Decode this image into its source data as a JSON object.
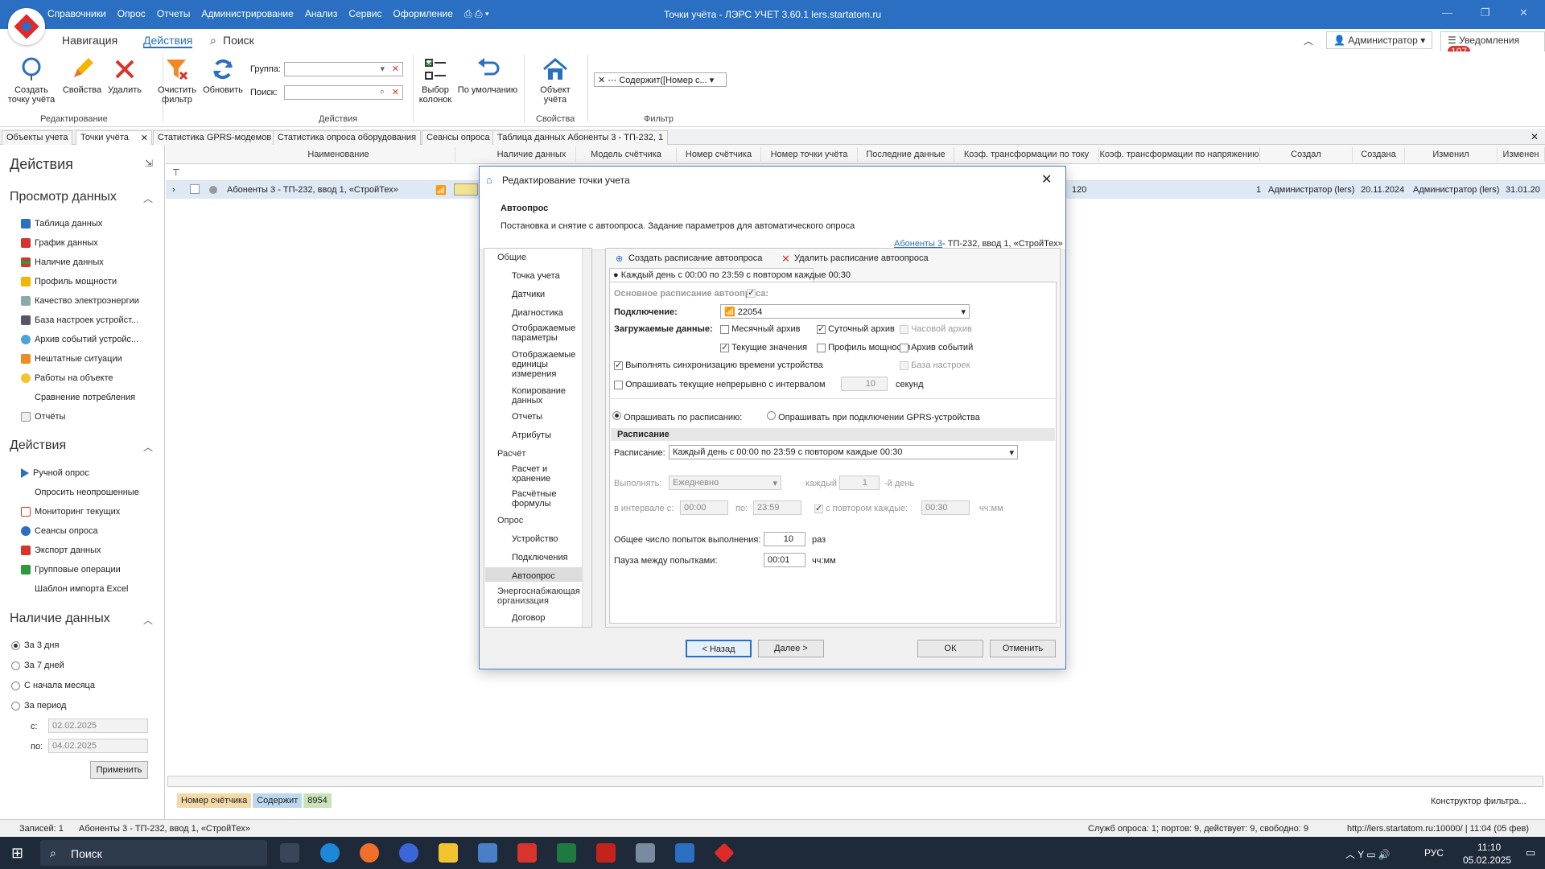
{
  "titlebar": {
    "title": "Точки учёта - ЛЭРС УЧЕТ 3.60.1 lers.startatom.ru",
    "menus": [
      "Справочники",
      "Опрос",
      "Отчеты",
      "Администрирование",
      "Анализ",
      "Сервис",
      "Оформление"
    ]
  },
  "ribbon_tabs": {
    "nav": "Навигация",
    "actions": "Действия",
    "search": "Поиск"
  },
  "user": {
    "name": "Администратор",
    "notifications": "Уведомления",
    "notif_count": "107"
  },
  "ribbon": {
    "create": "Создать точку учёта",
    "props": "Свойства",
    "delete": "Удалить",
    "clear_filter": "Очистить фильтр",
    "refresh": "Обновить",
    "group_label": "Группа:",
    "search_label": "Поиск:",
    "choose_cols": "Выбор колонок",
    "default": "По умолчанию",
    "object": "Объект учёта",
    "filter_chip": "Содержит([Номер с...",
    "grp_edit": "Редактирование",
    "grp_actions": "Действия",
    "grp_props": "Свойства",
    "grp_filter": "Фильтр"
  },
  "doc_tabs": [
    "Объекты учета",
    "Точки учёта",
    "Статистика GPRS-модемов",
    "Статистика опроса оборудования",
    "Сеансы опроса",
    "Таблица данных Абоненты 3 - ТП-232, 1"
  ],
  "left": {
    "title": "Действия",
    "view_header": "Просмотр данных",
    "view_items": [
      "Таблица данных",
      "График данных",
      "Наличие данных",
      "Профиль мощности",
      "Качество электроэнергии",
      "База настроек устройст...",
      "Архив событий устройс...",
      "Нештатные ситуации",
      "Работы на объекте",
      "Сравнение потребления",
      "Отчёты"
    ],
    "actions_header": "Действия",
    "action_items": [
      "Ручной опрос",
      "Опросить неопрошенные",
      "Мониторинг текущих",
      "Сеансы опроса",
      "Экспорт данных",
      "Групповые операции",
      "Шаблон импорта Excel"
    ],
    "avail_header": "Наличие данных",
    "avail_opts": [
      "За 3 дня",
      "За 7 дней",
      "С начала месяца",
      "За период"
    ],
    "from_label": "с:",
    "from_val": "02.02.2025",
    "to_label": "по:",
    "to_val": "04.02.2025",
    "apply": "Применить"
  },
  "grid": {
    "headers": [
      "Наименование",
      "Наличие данных",
      "Модель счётчика",
      "Номер счётчика",
      "Номер точки учёта",
      "Последние данные",
      "Коэф. трансформации по току",
      "Коэф. трансформации по напряжению",
      "Создал",
      "Создана",
      "Изменил",
      "Изменен"
    ],
    "row": {
      "name": "Абоненты 3 - ТП-232, ввод 1, «СтройТех»",
      "ct": "120",
      "vt": "1",
      "created_by": "Администратор (lers)",
      "created": "20.11.2024",
      "modified_by": "Администратор (lers)",
      "modified": "31.01.20"
    },
    "filter_chips": [
      "Номер счётчика",
      "Содержит",
      "8954"
    ],
    "filter_builder": "Конструктор фильтра..."
  },
  "dialog": {
    "title": "Редактирование точки учета",
    "section": "Автоопрос",
    "desc": "Постановка и снятие с автоопроса. Задание параметров для автоматического опроса",
    "link": "Абоненты 3",
    "link_rest": " - ТП-232, ввод 1, «СтройТех»",
    "tree": {
      "general": "Общие",
      "point": "Точка учета",
      "sensors": "Датчики",
      "diag": "Диагностика",
      "disp_params": "Отображаемые параметры",
      "disp_units": "Отображаемые единицы измерения",
      "copy": "Копирование данных",
      "reports": "Отчеты",
      "attrs": "Атрибуты",
      "calc": "Расчёт",
      "calc_store": "Расчет и хранение",
      "formulas": "Расчётные формулы",
      "poll": "Опрос",
      "device": "Устройство",
      "connections": "Подключения",
      "autopoll": "Автоопрос",
      "energy": "Энергоснабжающая организация",
      "contract": "Договор"
    },
    "toolbar": {
      "create": "Создать расписание автоопроса",
      "delete": "Удалить расписание автоопроса"
    },
    "schedule_tab": "Каждый день с 00:00 по 23:59 с повтором каждые 00:30",
    "main_schedule": "Основное расписание автоопроса:",
    "connection_label": "Подключение:",
    "connection": "22054",
    "loaded_label": "Загружаемые данные:",
    "cb": {
      "monthly": "Месячный архив",
      "daily": "Суточный архив",
      "hourly": "Часовой архив",
      "current": "Текущие значения",
      "power": "Профиль мощности",
      "events": "Архив событий",
      "settings": "База настроек"
    },
    "sync": "Выполнять синхронизацию времени устройства",
    "continuous": "Опрашивать текущие непрерывно с интервалом",
    "interval": "10",
    "seconds": "секунд",
    "by_schedule": "Опрашивать по расписанию:",
    "by_gprs": "Опрашивать при подключении GPRS-устройства",
    "sched_header": "Расписание",
    "sched_label": "Расписание:",
    "sched_val": "Каждый день с 00:00 по 23:59 с повтором каждые 00:30",
    "exec_label": "Выполнять:",
    "exec_val": "Ежедневно",
    "every": "каждый",
    "every_val": "1",
    "day_suffix": "-й день",
    "in_interval": "в интервале с:",
    "from": "00:00",
    "to_label": "по:",
    "to": "23:59",
    "repeat": "с повтором каждые:",
    "repeat_val": "00:30",
    "hhmm": "чч:мм",
    "attempts_label": "Общее число попыток выполнения:",
    "attempts": "10",
    "times": "раз",
    "pause_label": "Пауза между попытками:",
    "pause": "00:01",
    "hhmm2": "чч:мм",
    "back": "< Назад",
    "next": "Далее >",
    "ok": "ОК",
    "cancel": "Отменить"
  },
  "status": {
    "records": "Записей: 1",
    "point": "Абоненты 3 - ТП-232, ввод 1, «СтройТех»",
    "services": "Служб опроса: 1; портов: 9, действует: 9, свободно: 9",
    "server": "http://lers.startatom.ru:10000/ | 11:04 (05 фев)"
  },
  "taskbar": {
    "search": "Поиск",
    "lang": "РУС",
    "time": "11:10",
    "date": "05.02.2025"
  },
  "colors": {
    "accent": "#2a6fc1",
    "brand_red": "#e02a2a"
  }
}
